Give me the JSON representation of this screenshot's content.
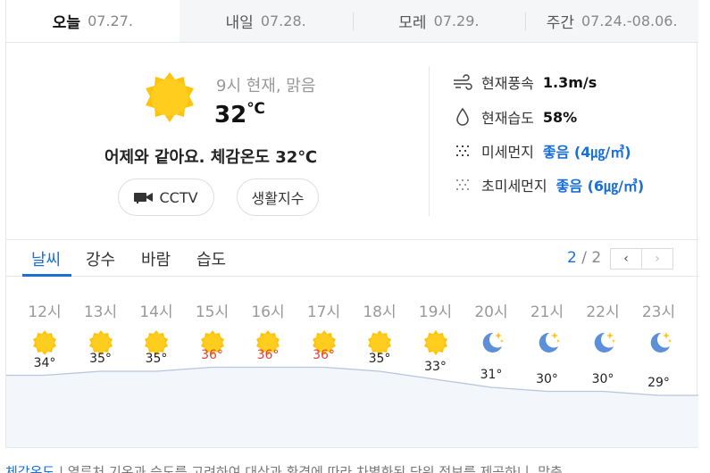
{
  "day_tabs": [
    {
      "label": "오늘",
      "date": "07.27."
    },
    {
      "label": "내일",
      "date": "07.28."
    },
    {
      "label": "모레",
      "date": "07.29."
    },
    {
      "label": "주간",
      "date": "07.24.-08.06."
    }
  ],
  "current": {
    "time_label": "9시 현재, 맑음",
    "temp": "32",
    "unit": "℃",
    "summary": "어제와 같아요.  체감온도 32℃",
    "cctv_label": "CCTV",
    "life_label": "생활지수"
  },
  "stats": {
    "wind": {
      "label": "현재풍속",
      "value": "1.3m/s"
    },
    "humidity": {
      "label": "현재습도",
      "value": "58%"
    },
    "dust": {
      "label": "미세먼지",
      "value": "좋음 (4㎍/㎥)"
    },
    "ultrafine": {
      "label": "초미세먼지",
      "value": "좋음 (6㎍/㎥)"
    }
  },
  "sub_tabs": [
    "날씨",
    "강수",
    "바람",
    "습도"
  ],
  "pager": {
    "current": "2",
    "sep": "/",
    "total": "2",
    "prev_icon": "chevron-left-icon",
    "next_icon": "chevron-right-icon"
  },
  "hourly": [
    {
      "hour": "12시",
      "temp": "34°",
      "icon": "sun-icon",
      "t": 34
    },
    {
      "hour": "13시",
      "temp": "35°",
      "icon": "sun-icon",
      "t": 35
    },
    {
      "hour": "14시",
      "temp": "35°",
      "icon": "sun-icon",
      "t": 35
    },
    {
      "hour": "15시",
      "temp": "36°",
      "icon": "sun-icon",
      "t": 36
    },
    {
      "hour": "16시",
      "temp": "36°",
      "icon": "sun-icon",
      "t": 36
    },
    {
      "hour": "17시",
      "temp": "36°",
      "icon": "sun-icon",
      "t": 36
    },
    {
      "hour": "18시",
      "temp": "35°",
      "icon": "sun-icon",
      "t": 35
    },
    {
      "hour": "19시",
      "temp": "33°",
      "icon": "sun-icon",
      "t": 33
    },
    {
      "hour": "20시",
      "temp": "31°",
      "icon": "moon-icon",
      "t": 31
    },
    {
      "hour": "21시",
      "temp": "30°",
      "icon": "moon-icon",
      "t": 30
    },
    {
      "hour": "22시",
      "temp": "30°",
      "icon": "moon-icon",
      "t": 30
    },
    {
      "hour": "23시",
      "temp": "29°",
      "icon": "moon-icon",
      "t": 29
    }
  ],
  "colors": {
    "accent": "#1a6fd8",
    "hot": "#e0423c",
    "sun": "#ffc30b",
    "moon": "#5b8fd9"
  },
  "footer": {
    "link": "체감온도",
    "text": "|  열류처 기온과 습도를 고려하여 대상과 환경에 따라 차별화된 단위 정보를 제공하니, 맞춤"
  }
}
